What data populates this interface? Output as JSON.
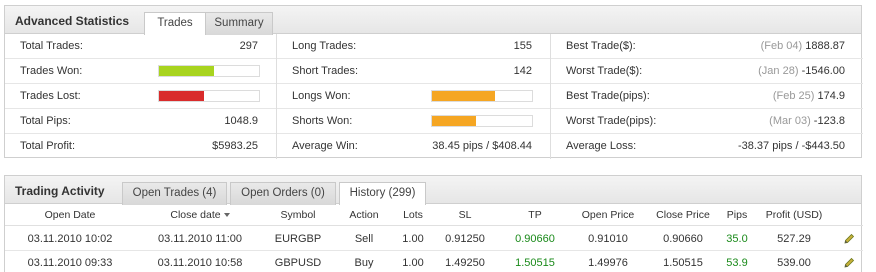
{
  "stats": {
    "title": "Advanced Statistics",
    "tabs": [
      {
        "label": "Trades"
      },
      {
        "label": "Summary"
      }
    ],
    "col1": [
      {
        "label": "Total Trades:",
        "value": "297"
      },
      {
        "label": "Trades Won:",
        "bar_fraction": 0.55,
        "bar_color": "#a8d41f"
      },
      {
        "label": "Trades Lost:",
        "bar_fraction": 0.45,
        "bar_color": "#d92b2b"
      },
      {
        "label": "Total Pips:",
        "value": "1048.9"
      },
      {
        "label": "Total Profit:",
        "value": "$5983.25"
      }
    ],
    "col2": [
      {
        "label": "Long Trades:",
        "value": "155"
      },
      {
        "label": "Short Trades:",
        "value": "142"
      },
      {
        "label": "Longs Won:",
        "bar_fraction": 0.63,
        "bar_color": "#f5a623"
      },
      {
        "label": "Shorts Won:",
        "bar_fraction": 0.44,
        "bar_color": "#f5a623"
      },
      {
        "label": "Average Win:",
        "value": "38.45 pips / $408.44"
      }
    ],
    "col3": [
      {
        "label": "Best Trade($):",
        "date": "(Feb 04)",
        "value": "1888.87"
      },
      {
        "label": "Worst Trade($):",
        "date": "(Jan 28)",
        "value": "-1546.00"
      },
      {
        "label": "Best Trade(pips):",
        "date": "(Feb 25)",
        "value": "174.9"
      },
      {
        "label": "Worst Trade(pips):",
        "date": "(Mar 03)",
        "value": "-123.8"
      },
      {
        "label": "Average Loss:",
        "date": "",
        "value": "-38.37 pips / -$443.50"
      }
    ]
  },
  "trading": {
    "title": "Trading Activity",
    "tabs": [
      {
        "label": "Open Trades (4)"
      },
      {
        "label": "Open Orders (0)"
      },
      {
        "label": "History (299)"
      }
    ],
    "columns": [
      "Open Date",
      "Close date",
      "Symbol",
      "Action",
      "Lots",
      "SL",
      "TP",
      "Open Price",
      "Close Price",
      "Pips",
      "Profit (USD)"
    ],
    "rows": [
      {
        "open_date": "03.11.2010 10:02",
        "close_date": "03.11.2010 11:00",
        "symbol": "EURGBP",
        "action": "Sell",
        "lots": "1.00",
        "sl": "0.91250",
        "tp": "0.90660",
        "open_price": "0.91010",
        "close_price": "0.90660",
        "pips": "35.0",
        "profit": "527.29"
      },
      {
        "open_date": "03.11.2010 09:33",
        "close_date": "03.11.2010 10:58",
        "symbol": "GBPUSD",
        "action": "Buy",
        "lots": "1.00",
        "sl": "1.49250",
        "tp": "1.50515",
        "open_price": "1.49976",
        "close_price": "1.50515",
        "pips": "53.9",
        "profit": "539.00"
      }
    ]
  },
  "colors": {
    "positive": "#1a8a1a",
    "border": "#cfcfcf"
  },
  "icons": {
    "row_action": "pencil-edit-icon"
  }
}
